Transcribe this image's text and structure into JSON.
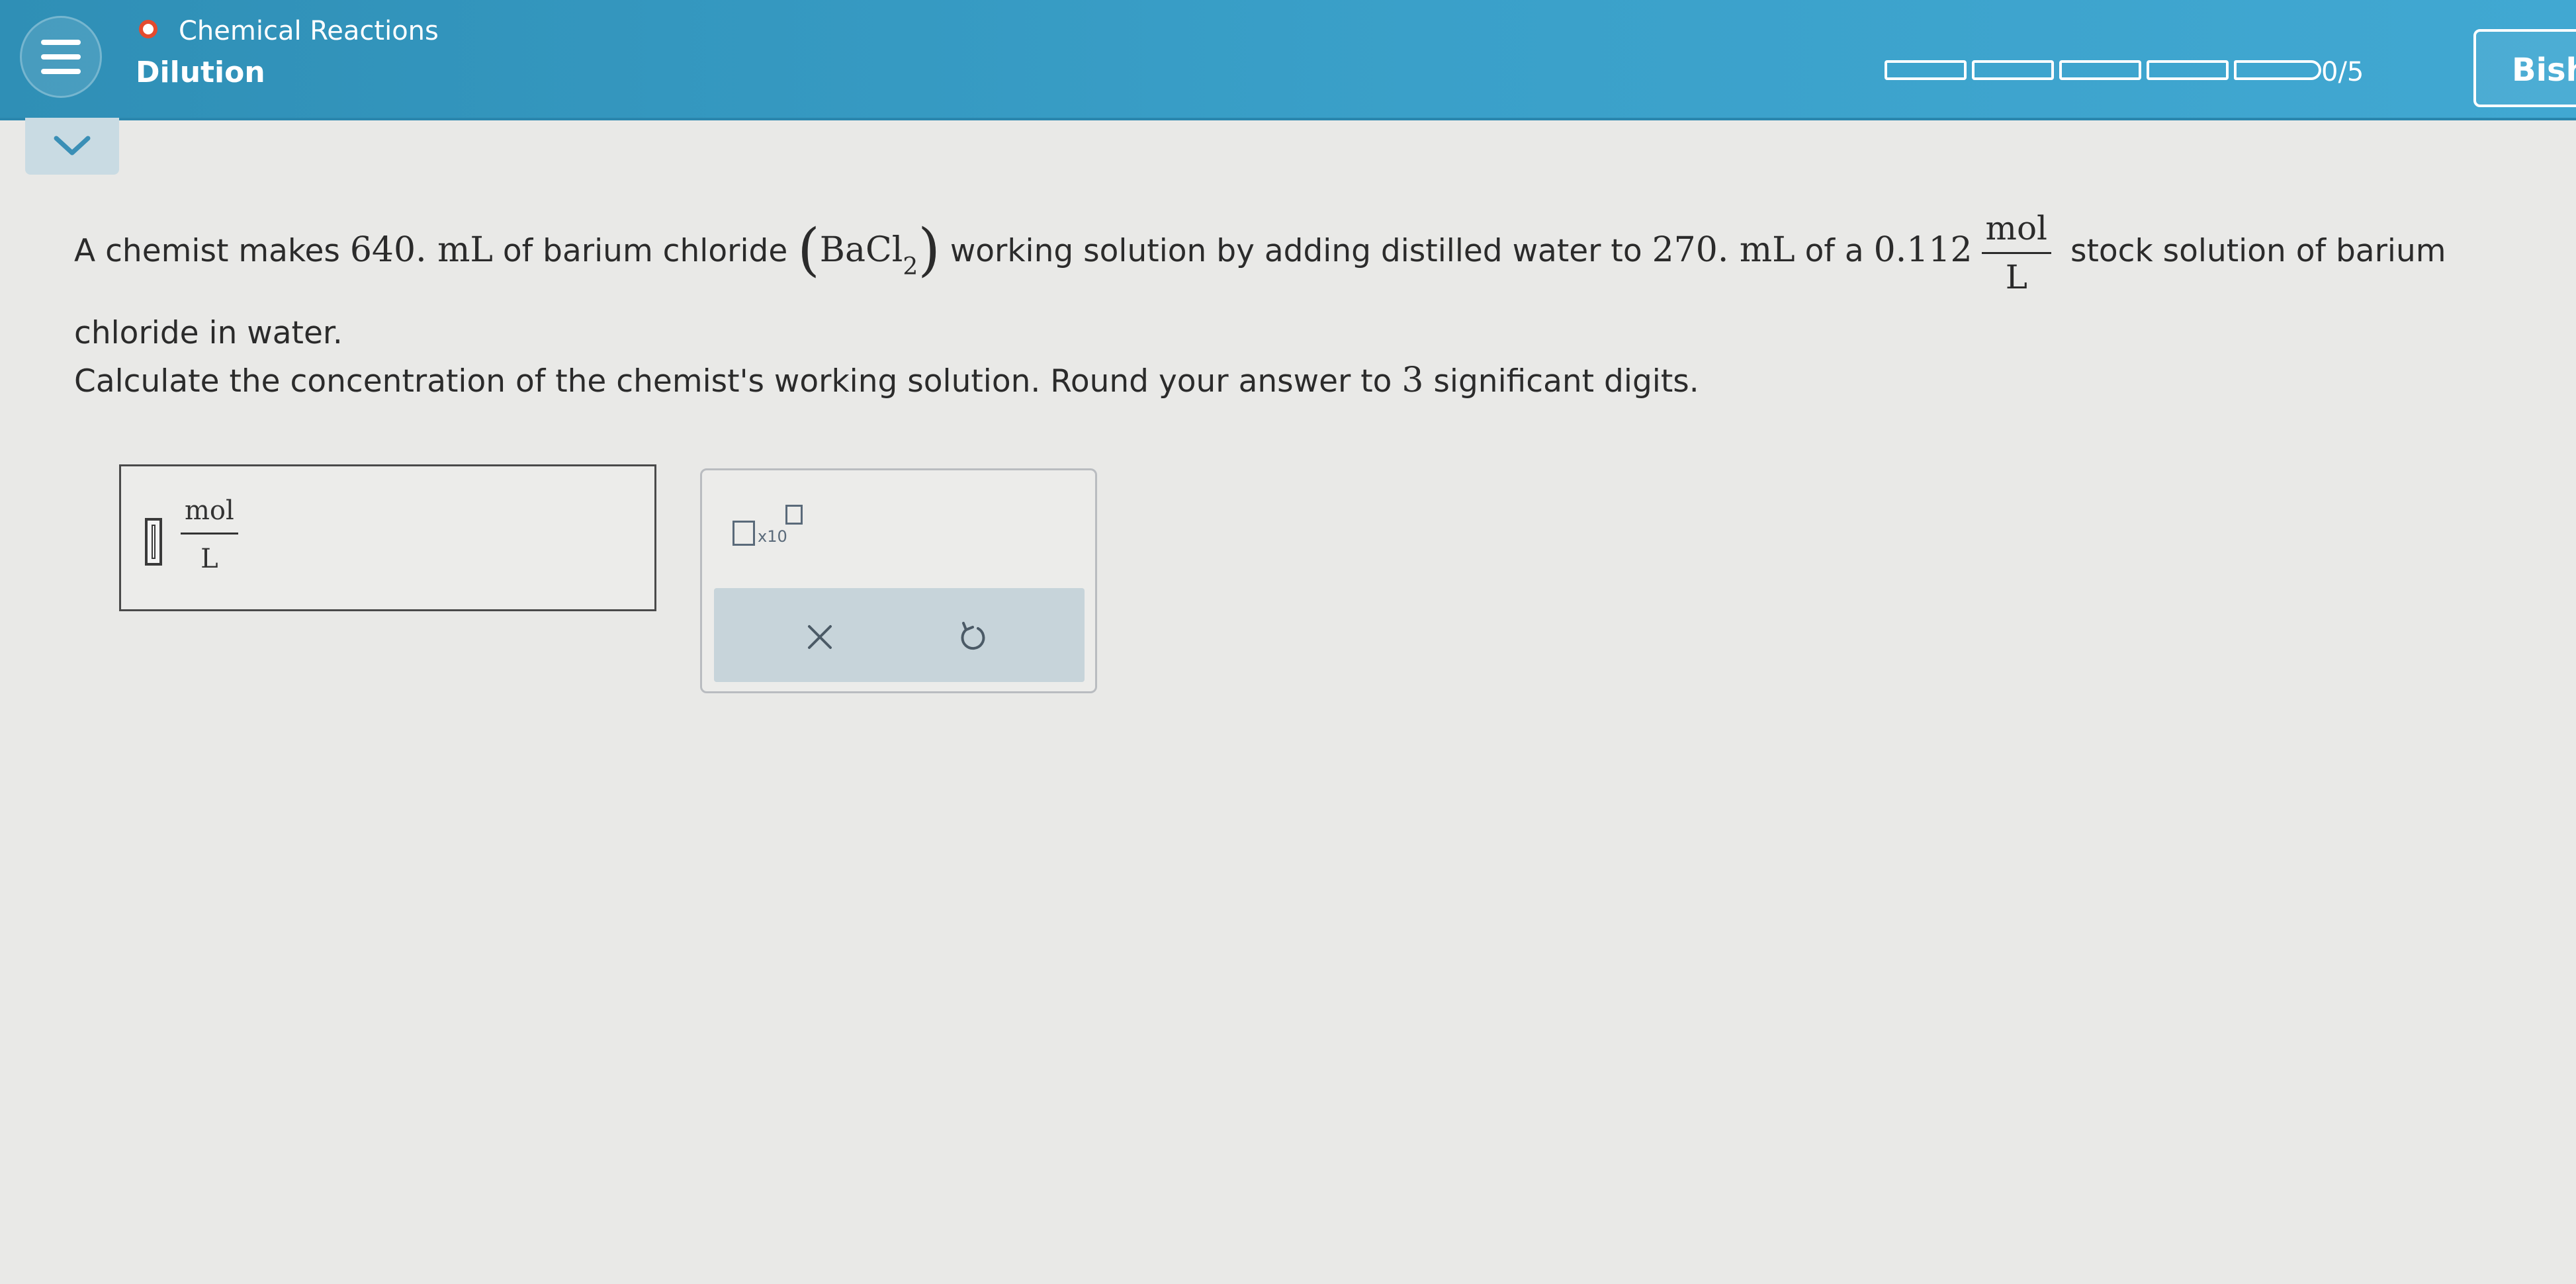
{
  "header": {
    "topic": "Chemical Reactions",
    "subtopic": "Dilution",
    "progress_text": "0/5",
    "progress_value": 0,
    "progress_total": 5,
    "user_button": "Bish"
  },
  "question": {
    "p1_a": "A chemist makes ",
    "vol1": "640. mL",
    "p1_b": " of barium chloride ",
    "formula_base": "BaCl",
    "formula_sub": "2",
    "p1_c": " working solution by adding distilled water to ",
    "vol2": "270. mL",
    "p1_d": " of a ",
    "conc": "0.112",
    "unit_num": "mol",
    "unit_den": "L",
    "p1_e": " stock solution of barium chloride in water.",
    "instruction_a": "Calculate the concentration of the chemist's working solution. Round your answer to ",
    "sig_figs": "3",
    "instruction_b": " significant digits."
  },
  "answer": {
    "unit_num": "mol",
    "unit_den": "L"
  },
  "tools": {
    "x10_label": "x10"
  },
  "colors": {
    "header_bg": "#3aa0c9",
    "topic_dot": "#e44a2e",
    "page_bg": "#e9e9e7"
  }
}
